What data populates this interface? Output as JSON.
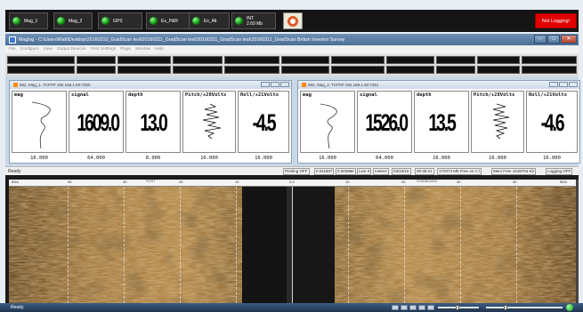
{
  "instruments": [
    {
      "label": "Mag_1",
      "extra": ""
    },
    {
      "label": "Mag_2",
      "extra": ""
    },
    {
      "label": "GPS",
      "extra": ""
    },
    {
      "label": "Ex_P&R",
      "extra": ""
    },
    {
      "label": "Ex_Alt",
      "extra": ""
    },
    {
      "label": "INT",
      "extra": "2.69 Mb"
    }
  ],
  "logging_status": "Not Logging!",
  "window": {
    "title": "Maglog - C:\\Users\\Matt\\Desktop\\20160310_GradScan test\\20160311_GradScan test\\20160311_GradScan test\\20160311_GradScan British Inventor Survey",
    "minimize": "–",
    "maximize": "□",
    "close": "✕"
  },
  "menu": [
    "File",
    "Configure",
    "View",
    "Output Devices",
    "Print Settings",
    "Flags",
    "Window",
    "Help"
  ],
  "panels": [
    {
      "title": "882, Mag_1, TCP/IP 192.168.1.50:7350",
      "columns": [
        {
          "header": "mag",
          "value": "",
          "footer": "16.000"
        },
        {
          "header": "signal",
          "value": "1609.0",
          "footer": "64.000"
        },
        {
          "header": "depth",
          "value": "13.0",
          "footer": "8.000"
        },
        {
          "header": "Pitch/+28Volts",
          "value": "",
          "footer": "16.000"
        },
        {
          "header": "Roll/+21Volts",
          "value": "-4.5",
          "footer": "16.000"
        }
      ]
    },
    {
      "title": "882, Mag_2, TCP/IP 192.168.1.50:7351",
      "columns": [
        {
          "header": "mag",
          "value": "",
          "footer": "16.000"
        },
        {
          "header": "signal",
          "value": "1526.0",
          "footer": "64.000"
        },
        {
          "header": "depth",
          "value": "13.5",
          "footer": "16.000"
        },
        {
          "header": "Pitch/+28Volts",
          "value": "",
          "footer": "16.000"
        },
        {
          "header": "Roll/+21Volts",
          "value": "-4.6",
          "footer": "16.000"
        }
      ]
    }
  ],
  "status": {
    "ready": "Ready",
    "printing": "Printing OFF",
    "val1": "0.011887",
    "val2": "0.003966",
    "line": "Line 0",
    "units": "meters",
    "date": "03/15/16",
    "time": "06:39:21",
    "disk": "170373 Mb Free on C:\\",
    "mem": "Mem Free 1549704 Kb",
    "logging": "Logging OFF"
  },
  "sonar": {
    "left_range": "50m",
    "right_range": "50m",
    "port_label": "PORT",
    "starboard_label": "STARBOARD",
    "ticks_left": [
      "40",
      "30",
      "20",
      "10"
    ],
    "center": "0.0",
    "ticks_right": [
      "10",
      "20",
      "30",
      "40"
    ]
  },
  "taskbar": {
    "ready": "Ready."
  },
  "colors": {
    "led_green": "#19c019",
    "alert_red": "#e00000",
    "sonar_sand": "#b48a4c"
  }
}
